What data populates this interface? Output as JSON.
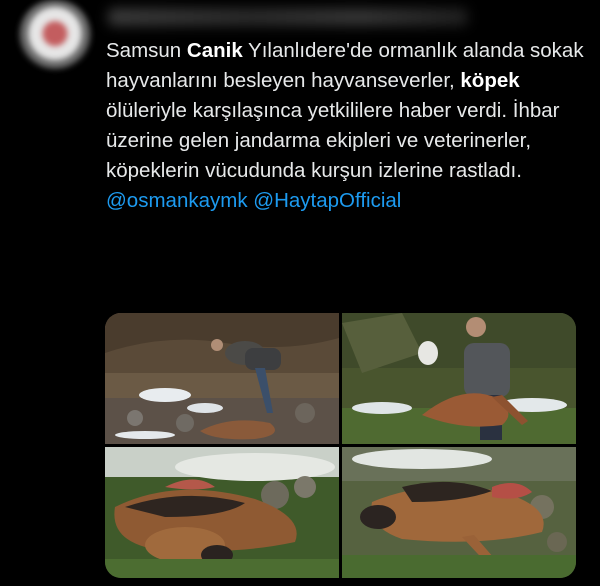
{
  "tweet": {
    "text_parts": [
      {
        "t": "Samsun ",
        "b": false
      },
      {
        "t": "Canik",
        "b": true
      },
      {
        "t": " Yılanlıdere'de ormanlık alanda sokak hayvanlarını besleyen hayvanseverler, ",
        "b": false
      },
      {
        "t": "köpek",
        "b": true
      },
      {
        "t": " ölüleriyle karşılaşınca yetkililere haber verdi. İhbar üzerine gelen jandarma ekipleri ve veterinerler, köpeklerin vücudunda kurşun izlerine rastladı.",
        "b": false
      }
    ],
    "mentions": [
      "@osmankaymk",
      "@HaytapOfficial"
    ]
  },
  "colors": {
    "background": "#000000",
    "text": "#e7e9ea",
    "mention": "#1d9bf0"
  },
  "media": {
    "count": 4,
    "photos": [
      "photo-man-kneeling-by-dog",
      "photo-man-holding-dog",
      "photo-dead-dog-closeup-left",
      "photo-dead-dog-closeup-right"
    ]
  }
}
